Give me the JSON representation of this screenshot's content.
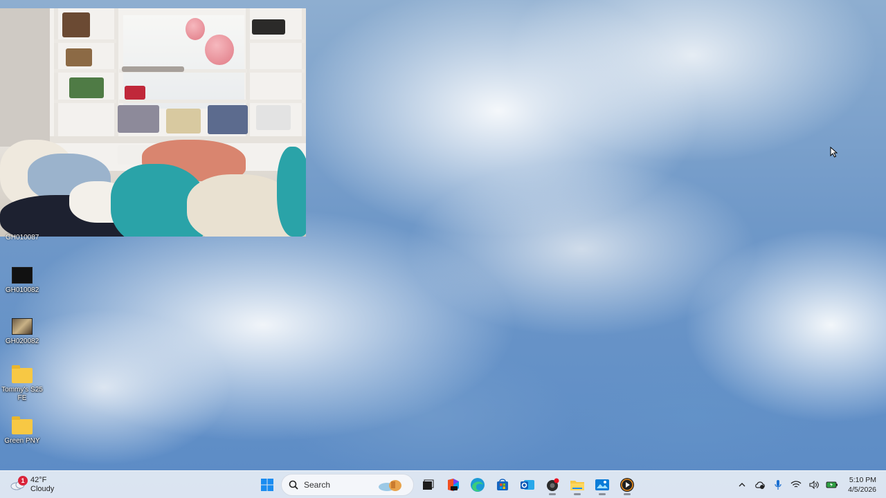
{
  "desktop": {
    "partial_icon_label": "GH010087",
    "icons": [
      {
        "label": "GH010082",
        "type": "video"
      },
      {
        "label": "GH020082",
        "type": "video"
      },
      {
        "label": "Tommy's S25 FE",
        "type": "folder"
      },
      {
        "label": "Green PNY",
        "type": "folder"
      }
    ]
  },
  "taskbar": {
    "weather": {
      "notification_count": "1",
      "temperature": "42°F",
      "condition": "Cloudy"
    },
    "search": {
      "placeholder": "Search"
    },
    "apps": [
      {
        "name": "start",
        "icon": "windows-logo-icon"
      },
      {
        "name": "task-view",
        "icon": "task-view-icon"
      },
      {
        "name": "microsoft-365",
        "icon": "office-icon"
      },
      {
        "name": "edge",
        "icon": "edge-icon"
      },
      {
        "name": "store",
        "icon": "store-icon"
      },
      {
        "name": "outlook",
        "icon": "outlook-icon"
      },
      {
        "name": "camera-app",
        "icon": "camera-icon"
      },
      {
        "name": "file-explorer",
        "icon": "folder-icon"
      },
      {
        "name": "photos",
        "icon": "photos-icon"
      },
      {
        "name": "media-player",
        "icon": "play-icon"
      }
    ],
    "clock": {
      "time": "5:10 PM",
      "date": "4/5/2026"
    }
  },
  "colors": {
    "accent": "#0078d4",
    "badge": "#d9243a",
    "folder": "#f7c844"
  }
}
